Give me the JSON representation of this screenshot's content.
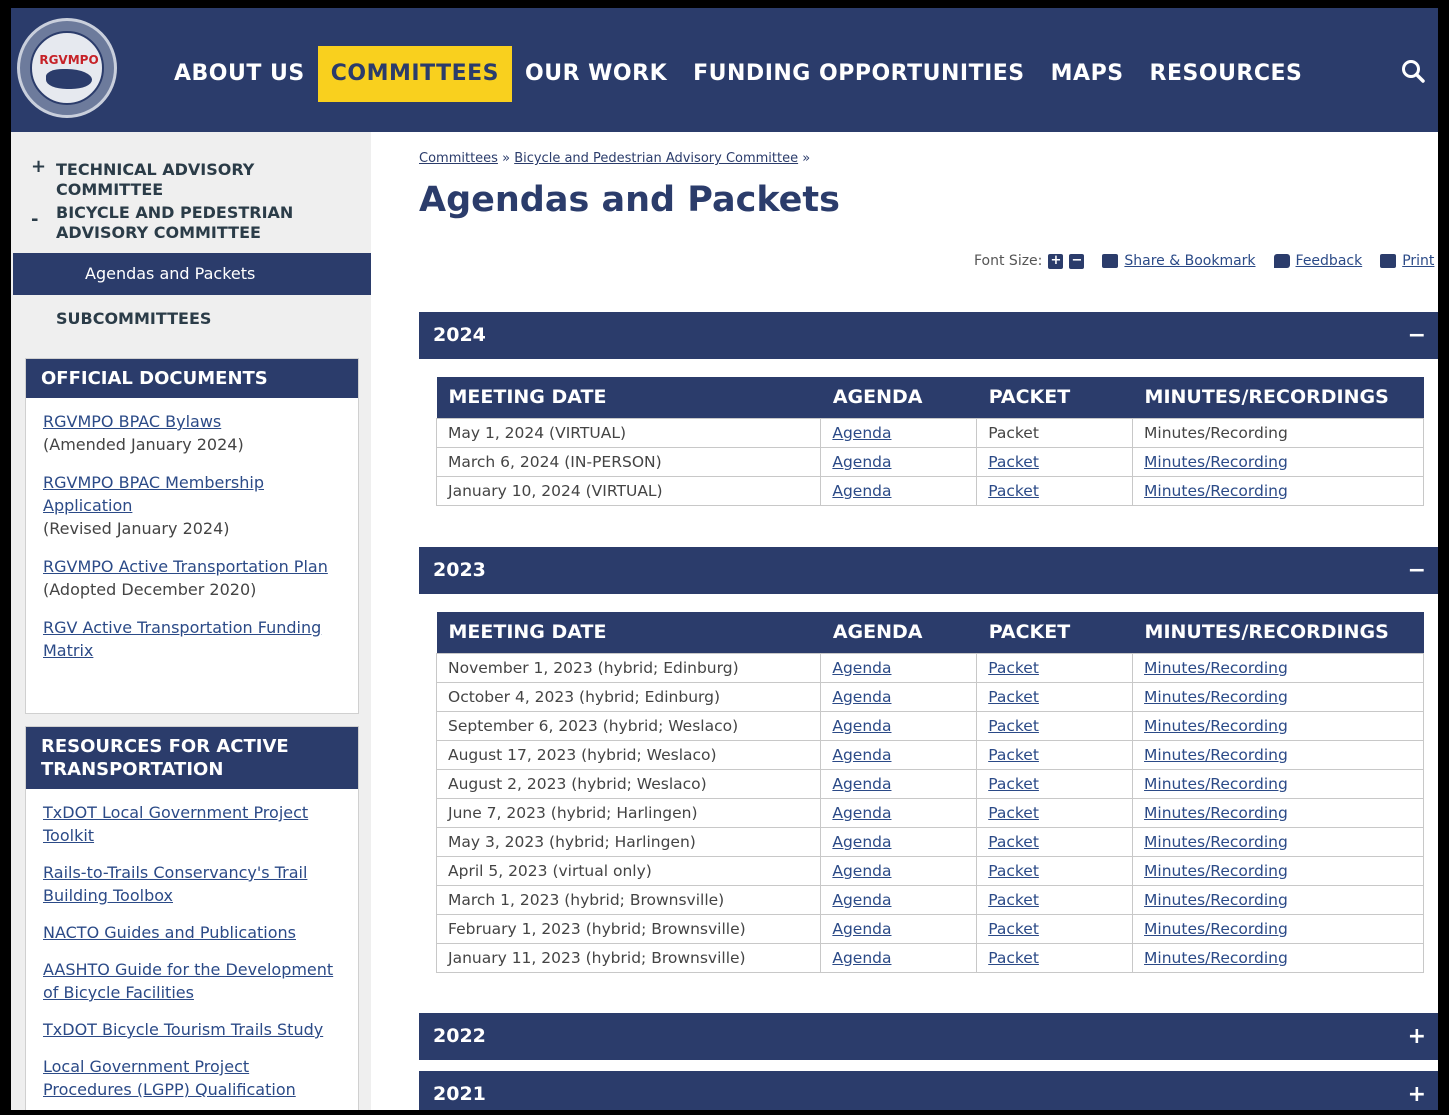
{
  "logo": {
    "text": "RGVMPO",
    "ring_text": "RIO GRANDE VALLEY"
  },
  "nav": {
    "items": [
      {
        "label": "ABOUT US",
        "active": false
      },
      {
        "label": "COMMITTEES",
        "active": true
      },
      {
        "label": "OUR WORK",
        "active": false
      },
      {
        "label": "FUNDING OPPORTUNITIES",
        "active": false
      },
      {
        "label": "MAPS",
        "active": false
      },
      {
        "label": "RESOURCES",
        "active": false
      }
    ],
    "search_icon": "search-icon"
  },
  "sidebar": {
    "technical": {
      "sign": "+",
      "label": "TECHNICAL ADVISORY COMMITTEE"
    },
    "bicycle": {
      "sign": "-",
      "label": "BICYCLE AND PEDESTRIAN ADVISORY COMMITTEE"
    },
    "sub_active": "Agendas and Packets",
    "subcommittees": "SUBCOMMITTEES",
    "official": {
      "heading": "OFFICIAL DOCUMENTS",
      "docs": [
        {
          "link": "RGVMPO BPAC Bylaws",
          "note": "(Amended January 2024)"
        },
        {
          "link": "RGVMPO BPAC Membership Application",
          "note": "(Revised January 2024)"
        },
        {
          "link": "RGVMPO Active Transportation Plan",
          "note": "(Adopted December 2020)"
        },
        {
          "link": "RGV Active Transportation Funding Matrix",
          "note": ""
        }
      ]
    },
    "resources": {
      "heading": "RESOURCES FOR ACTIVE TRANSPORTATION",
      "links": [
        "TxDOT Local Government Project Toolkit",
        "Rails-to-Trails Conservancy's Trail Building Toolbox",
        "NACTO Guides and Publications",
        "AASHTO Guide for the Development of Bicycle Facilities",
        "TxDOT Bicycle Tourism Trails Study",
        "Local Government Project Procedures (LGPP) Qualification"
      ]
    }
  },
  "breadcrumb": {
    "item1": "Committees",
    "item2": "Bicycle and Pedestrian Advisory Committee",
    "sep": "»"
  },
  "page_title": "Agendas and Packets",
  "tools": {
    "font_size": "Font Size:",
    "share": "Share & Bookmark",
    "feedback": "Feedback",
    "print": "Print"
  },
  "table_headers": {
    "date": "MEETING DATE",
    "agenda": "AGENDA",
    "packet": "PACKET",
    "minutes": "MINUTES/RECORDINGS"
  },
  "years": [
    {
      "year": "2024",
      "toggle": "−",
      "expanded": true,
      "rows": [
        {
          "date": "May 1, 2024 (VIRTUAL)",
          "agenda": "Agenda",
          "packet": "Packet",
          "packet_link": false,
          "minutes": "Minutes/Recording",
          "minutes_link": false
        },
        {
          "date": "March 6, 2024 (IN-PERSON)",
          "agenda": "Agenda",
          "packet": "Packet",
          "packet_link": true,
          "minutes": "Minutes/Recording",
          "minutes_link": true
        },
        {
          "date": "January 10, 2024 (VIRTUAL)",
          "agenda": "Agenda",
          "packet": "Packet",
          "packet_link": true,
          "minutes": "Minutes/Recording",
          "minutes_link": true
        }
      ]
    },
    {
      "year": "2023",
      "toggle": "−",
      "expanded": true,
      "rows": [
        {
          "date": "November 1, 2023 (hybrid; Edinburg)",
          "agenda": "Agenda",
          "packet": "Packet",
          "packet_link": true,
          "minutes": "Minutes/Recording",
          "minutes_link": true
        },
        {
          "date": "October 4, 2023 (hybrid; Edinburg)",
          "agenda": "Agenda",
          "packet": "Packet",
          "packet_link": true,
          "minutes": "Minutes/Recording",
          "minutes_link": true
        },
        {
          "date": "September 6, 2023 (hybrid; Weslaco)",
          "agenda": "Agenda",
          "packet": "Packet",
          "packet_link": true,
          "minutes": "Minutes/Recording",
          "minutes_link": true
        },
        {
          "date": "August 17, 2023 (hybrid; Weslaco)",
          "agenda": "Agenda",
          "packet": "Packet",
          "packet_link": true,
          "minutes": "Minutes/Recording",
          "minutes_link": true
        },
        {
          "date": "August 2, 2023 (hybrid; Weslaco)",
          "agenda": "Agenda",
          "packet": "Packet",
          "packet_link": true,
          "minutes": "Minutes/Recording",
          "minutes_link": true
        },
        {
          "date": "June 7, 2023 (hybrid; Harlingen)",
          "agenda": "Agenda",
          "packet": "Packet",
          "packet_link": true,
          "minutes": "Minutes/Recording",
          "minutes_link": true
        },
        {
          "date": "May 3, 2023 (hybrid; Harlingen)",
          "agenda": "Agenda",
          "packet": "Packet",
          "packet_link": true,
          "minutes": "Minutes/Recording",
          "minutes_link": true
        },
        {
          "date": "April 5, 2023 (virtual only)",
          "agenda": "Agenda",
          "packet": "Packet",
          "packet_link": true,
          "minutes": "Minutes/Recording",
          "minutes_link": true
        },
        {
          "date": "March 1, 2023 (hybrid; Brownsville)",
          "agenda": "Agenda",
          "packet": "Packet",
          "packet_link": true,
          "minutes": "Minutes/Recording",
          "minutes_link": true
        },
        {
          "date": "February 1, 2023 (hybrid; Brownsville)",
          "agenda": "Agenda",
          "packet": "Packet",
          "packet_link": true,
          "minutes": "Minutes/Recording",
          "minutes_link": true
        },
        {
          "date": "January 11, 2023 (hybrid; Brownsville)",
          "agenda": "Agenda",
          "packet": "Packet",
          "packet_link": true,
          "minutes": "Minutes/Recording",
          "minutes_link": true
        }
      ]
    },
    {
      "year": "2022",
      "toggle": "+",
      "expanded": false,
      "rows": []
    },
    {
      "year": "2021",
      "toggle": "+",
      "expanded": false,
      "rows": []
    }
  ]
}
